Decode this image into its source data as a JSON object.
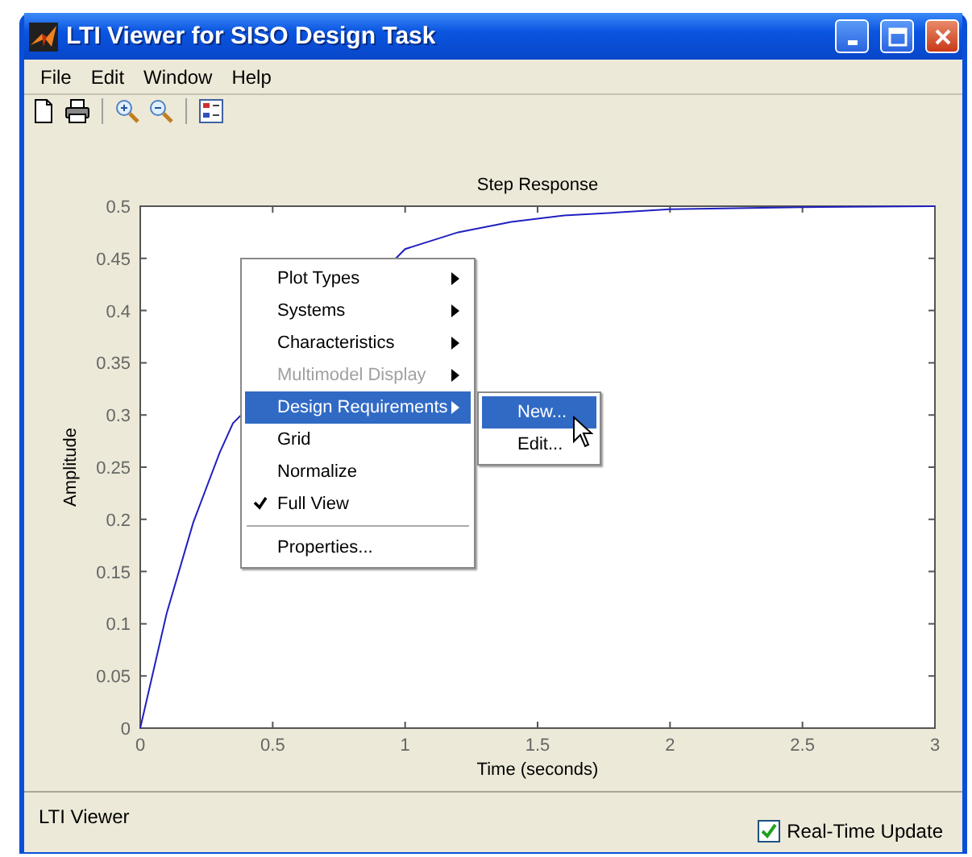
{
  "window": {
    "title": "LTI Viewer for SISO Design Task"
  },
  "menu_bar": [
    "File",
    "Edit",
    "Window",
    "Help"
  ],
  "toolbar": [
    {
      "kind": "new"
    },
    {
      "kind": "print"
    },
    {
      "kind": "separator"
    },
    {
      "kind": "zoom_in"
    },
    {
      "kind": "zoom_out"
    },
    {
      "kind": "separator"
    },
    {
      "kind": "legend"
    }
  ],
  "plot": {
    "chart_data": {
      "type": "line",
      "title": "Step Response",
      "xlabel": "Time (seconds)",
      "ylabel": "Amplitude",
      "x": [
        0,
        0.1,
        0.2,
        0.3,
        0.35,
        1.0,
        1.2,
        1.4,
        1.6,
        1.8,
        2.0,
        2.5,
        3.0
      ],
      "series": [
        {
          "color": "#2020c0",
          "values": [
            0,
            0.11,
            0.197,
            0.264,
            0.292,
            0.459,
            0.475,
            0.485,
            0.491,
            0.494,
            0.497,
            0.499,
            0.5
          ]
        }
      ],
      "xlim": [
        0,
        3
      ],
      "ylim": [
        0,
        0.5
      ],
      "xticks": [
        0,
        0.5,
        1,
        1.5,
        2,
        2.5,
        3
      ],
      "yticks": [
        0,
        0.05,
        0.1,
        0.15,
        0.2,
        0.25,
        0.3,
        0.35,
        0.4,
        0.45,
        0.5
      ]
    }
  },
  "context_menu": {
    "items": [
      {
        "label": "Plot Types",
        "kind": "submenu",
        "selected": false,
        "disabled": false,
        "checked": false
      },
      {
        "label": "Systems",
        "kind": "submenu",
        "selected": false,
        "disabled": false,
        "checked": false
      },
      {
        "label": "Characteristics",
        "kind": "submenu",
        "selected": false,
        "disabled": false,
        "checked": false
      },
      {
        "label": "Multimodel Display",
        "kind": "submenu",
        "selected": false,
        "disabled": true,
        "checked": false
      },
      {
        "label": "Design Requirements",
        "kind": "submenu",
        "selected": true,
        "disabled": false,
        "checked": false
      },
      {
        "label": "Grid",
        "kind": "item",
        "selected": false,
        "disabled": false,
        "checked": false
      },
      {
        "label": "Normalize",
        "kind": "item",
        "selected": false,
        "disabled": false,
        "checked": false
      },
      {
        "label": "Full View",
        "kind": "item",
        "selected": false,
        "disabled": false,
        "checked": true
      },
      {
        "label": "Properties...",
        "kind": "separated",
        "selected": false,
        "disabled": false,
        "checked": false
      }
    ],
    "submenu": [
      {
        "label": "New...",
        "selected": true
      },
      {
        "label": "Edit...",
        "selected": false
      }
    ]
  },
  "status_bar": {
    "text": "LTI Viewer",
    "realtime_update": {
      "label": "Real-Time Update",
      "checked": true
    }
  }
}
